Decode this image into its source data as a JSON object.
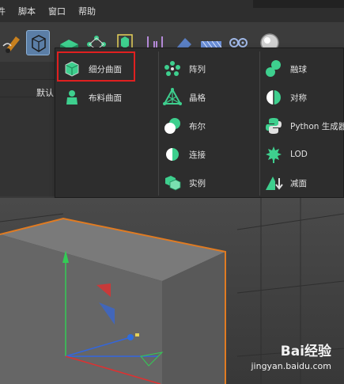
{
  "menubar": {
    "items": [
      "件",
      "脚本",
      "窗口",
      "帮助"
    ]
  },
  "toolbar": {
    "tools": [
      "pen-tool",
      "subdivision-surface-generator",
      "extrude-generator",
      "array-generator",
      "cube-generator",
      "deformer",
      "bend-deformer",
      "field",
      "camera",
      "light"
    ]
  },
  "side": {
    "default_label": "默认"
  },
  "dropdown": {
    "column1": [
      {
        "label": "细分曲面",
        "icon": "subdivision-surface-icon"
      },
      {
        "label": "布料曲面",
        "icon": "cloth-surface-icon"
      }
    ],
    "column2": [
      {
        "label": "阵列",
        "icon": "array-icon"
      },
      {
        "label": "晶格",
        "icon": "lattice-icon"
      },
      {
        "label": "布尔",
        "icon": "boolean-icon"
      },
      {
        "label": "连接",
        "icon": "connect-icon"
      },
      {
        "label": "实例",
        "icon": "instance-icon"
      }
    ],
    "column3": [
      {
        "label": "融球",
        "icon": "metaball-icon"
      },
      {
        "label": "对称",
        "icon": "symmetry-icon"
      },
      {
        "label": "Python 生成器",
        "icon": "python-generator-icon"
      },
      {
        "label": "LOD",
        "icon": "lod-icon"
      },
      {
        "label": "减面",
        "icon": "polygon-reduction-icon"
      }
    ],
    "highlight_color": "#e02020"
  },
  "watermark": {
    "logo": "Bai经验",
    "url": "jingyan.baidu.com"
  },
  "colors": {
    "accent_green": "#3ecf8e",
    "selection_orange": "#e07b22",
    "axis_red": "#e03030",
    "axis_green": "#33cc55",
    "axis_blue": "#3366dd"
  }
}
